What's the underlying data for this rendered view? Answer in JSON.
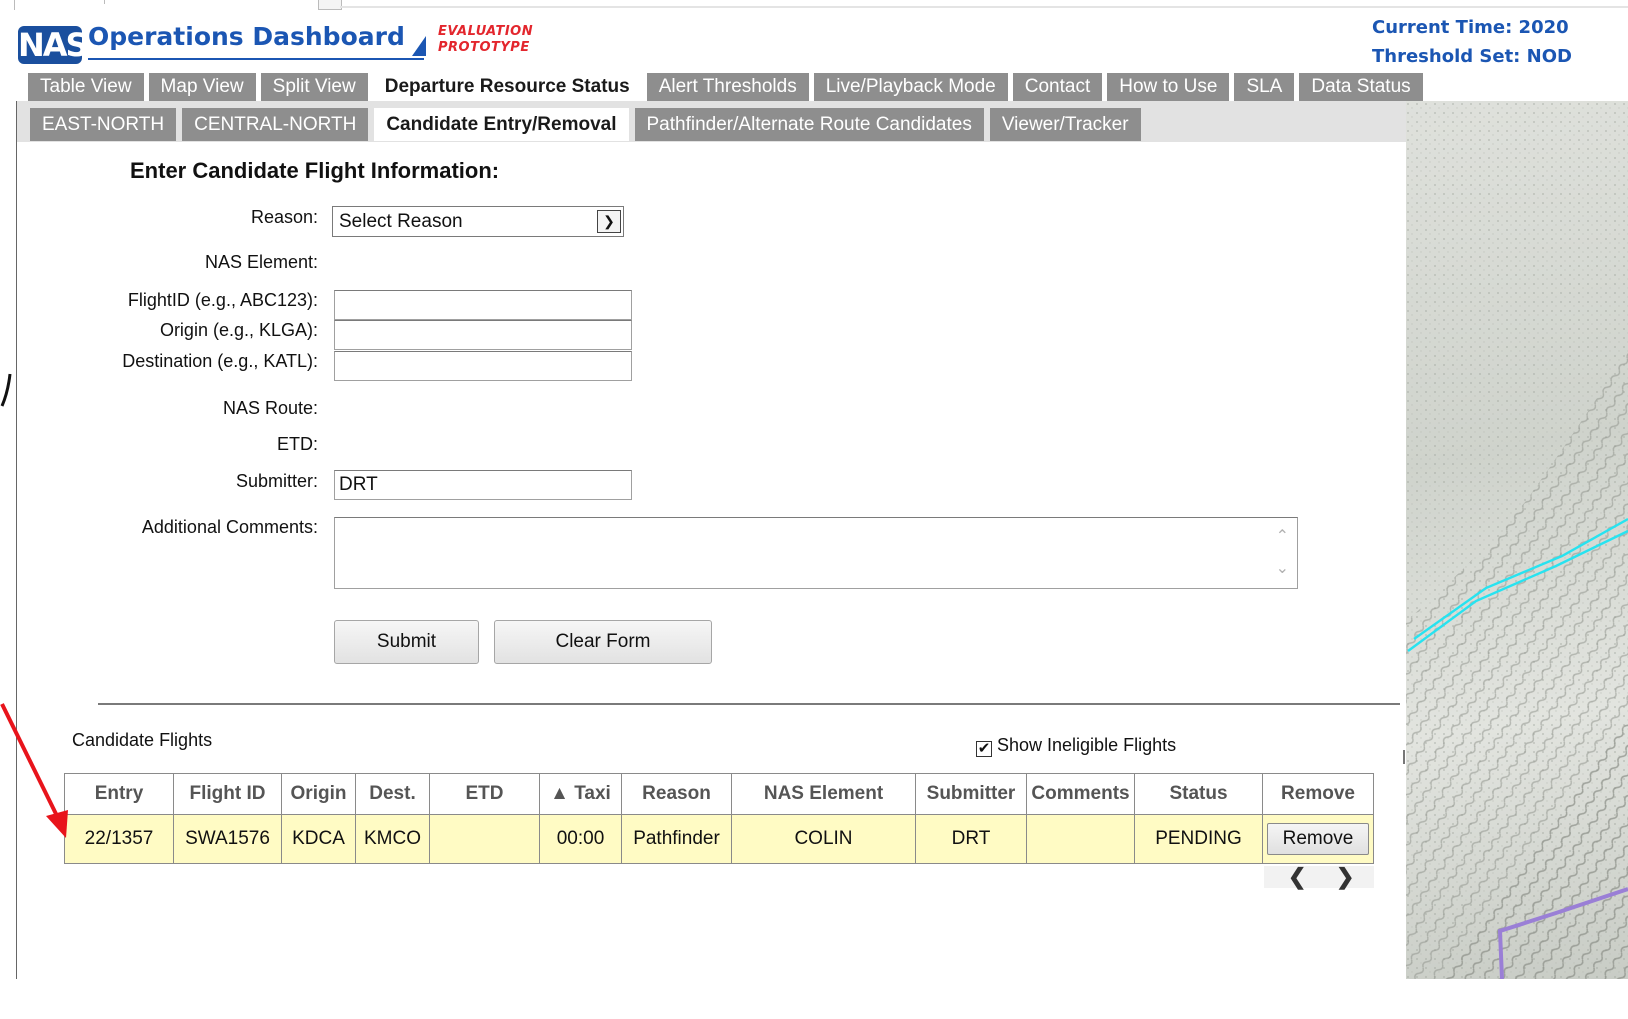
{
  "header": {
    "logo_text": "NAS",
    "app_title": "Operations Dashboard",
    "eval_line1": "EVALUATION",
    "eval_line2": "PROTOTYPE",
    "current_time": "Current  Time:  2020",
    "threshold_set": "Threshold Set:  NOD"
  },
  "main_tabs": [
    {
      "label": "Table View"
    },
    {
      "label": "Map View"
    },
    {
      "label": "Split View"
    },
    {
      "label": "Departure Resource Status",
      "active": true
    },
    {
      "label": "Alert Thresholds"
    },
    {
      "label": "Live/Playback Mode"
    },
    {
      "label": "Contact"
    },
    {
      "label": "How to Use"
    },
    {
      "label": "SLA"
    },
    {
      "label": "Data Status"
    }
  ],
  "sub_tabs": [
    {
      "label": "EAST-NORTH"
    },
    {
      "label": "CENTRAL-NORTH"
    },
    {
      "label": "Candidate Entry/Removal",
      "active": true
    },
    {
      "label": "Pathfinder/Alternate Route Candidates"
    },
    {
      "label": "Viewer/Tracker"
    }
  ],
  "form": {
    "heading": "Enter Candidate Flight Information:",
    "reason_label": "Reason:",
    "reason_value": "Select Reason",
    "nas_element_label": "NAS Element:",
    "flight_id_label": "FlightID (e.g., ABC123):",
    "flight_id_value": "",
    "origin_label": "Origin (e.g., KLGA):",
    "origin_value": "",
    "destination_label": "Destination (e.g., KATL):",
    "destination_value": "",
    "nas_route_label": "NAS Route:",
    "etd_label": "ETD:",
    "submitter_label": "Submitter:",
    "submitter_value": "DRT",
    "comments_label": "Additional Comments:",
    "comments_value": "",
    "submit_label": "Submit",
    "clear_label": "Clear Form"
  },
  "candidates": {
    "title": "Candidate Flights",
    "show_ineligible_label": "Show Ineligible Flights",
    "show_ineligible_checked": true,
    "columns": [
      "Entry",
      "Flight ID",
      "Origin",
      "Dest.",
      "ETD",
      "▲ Taxi",
      "Reason",
      "NAS Element",
      "Submitter",
      "Comments",
      "Status",
      "Remove"
    ],
    "rows": [
      {
        "entry": "22/1357",
        "flight_id": "SWA1576",
        "origin": "KDCA",
        "dest": "KMCO",
        "etd": "",
        "taxi": "00:00",
        "reason": "Pathfinder",
        "nas_element": "COLIN",
        "submitter": "DRT",
        "comments": "",
        "status": "PENDING",
        "remove_label": "Remove"
      }
    ],
    "pager_prev": "❮",
    "pager_next": "❯"
  },
  "colors": {
    "brand_blue": "#1b56b3",
    "eval_red": "#e3262d",
    "tab_gray": "#8e8e8e",
    "row_yellow": "#fffbc4",
    "annotation_red": "#e8141b",
    "route_cyan": "#27e3f0",
    "route_purple": "#9a7fd6"
  },
  "icons": {
    "select_arrow": "chevron-down-icon",
    "checkbox_mark": "✔",
    "scroll_up": "˄",
    "scroll_down": "˅"
  }
}
